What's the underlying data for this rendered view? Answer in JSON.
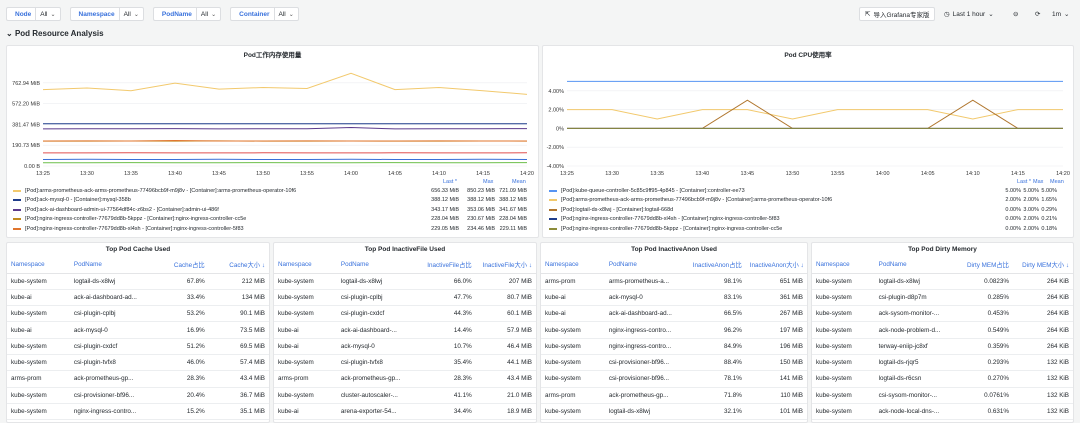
{
  "toolbar": {
    "variables": [
      {
        "label": "Node",
        "value": "All"
      },
      {
        "label": "Namespace",
        "value": "All"
      },
      {
        "label": "PodName",
        "value": "All"
      },
      {
        "label": "Container",
        "value": "All"
      }
    ],
    "import_label": "导入Grafana专家版",
    "time_range": "Last 1 hour",
    "refresh_interval": "1m"
  },
  "row_title": "Pod Resource Analysis",
  "memory_panel": {
    "title": "Pod工作内存使用量",
    "legend_headers": {
      "last": "Last *",
      "max": "Max",
      "mean": "Mean"
    },
    "legend": [
      {
        "name": "[Pod]:arms-prometheus-ack-arms-prometheus-77496bcb9f-m9j8v - [Container]:arms-prometheus-operator-10f6",
        "last": "656.33 MiB",
        "max": "850.23 MiB",
        "mean": "721.09 MiB",
        "color": "#f2c96d"
      },
      {
        "name": "[Pod]:ack-mysql-0 - [Container]:mysql-358b",
        "last": "388.12 MiB",
        "max": "388.12 MiB",
        "mean": "388.12 MiB",
        "color": "#1f3d8b"
      },
      {
        "name": "[Pod]:ack-ai-dashboard-admin-ui-77564df84c-z6bs2 - [Container]:admin-ui-486f",
        "last": "343.17 MiB",
        "max": "353.06 MiB",
        "mean": "341.67 MiB",
        "color": "#5b3a8c"
      },
      {
        "name": "[Pod]:nginx-ingress-controller-77679dd8b-5kppz - [Container]:nginx-ingress-controller-cc5e",
        "last": "228.04 MiB",
        "max": "230.67 MiB",
        "mean": "228.04 MiB",
        "color": "#c08a1e"
      },
      {
        "name": "[Pod]:nginx-ingress-controller-77679dd8b-xl4sh - [Container]:nginx-ingress-controller-5f83",
        "last": "229.05 MiB",
        "max": "234.46 MiB",
        "mean": "229.11 MiB",
        "color": "#e0752d"
      }
    ]
  },
  "cpu_panel": {
    "title": "Pod CPU使用率",
    "legend_headers": {
      "last": "Last *",
      "max": "Max",
      "mean": "Mean"
    },
    "legend": [
      {
        "name": "[Pod]:kube-queue-controller-5c85c9ff95-4p845 - [Container]:controller-ee73",
        "last": "5.00%",
        "max": "5.00%",
        "mean": "5.00%",
        "color": "#5794f2"
      },
      {
        "name": "[Pod]:arms-prometheus-ack-arms-prometheus-77496bcb9f-m9j8v - [Container]:arms-prometheus-operator-10f6",
        "last": "2.00%",
        "max": "2.00%",
        "mean": "1.65%",
        "color": "#f2c96d"
      },
      {
        "name": "[Pod]:logtail-ds-x8lwj - [Container]:logtail-668d",
        "last": "0.00%",
        "max": "3.00%",
        "mean": "0.29%",
        "color": "#b0762e"
      },
      {
        "name": "[Pod]:nginx-ingress-controller-77679dd8b-xl4sh - [Container]:nginx-ingress-controller-5f83",
        "last": "0.00%",
        "max": "2.00%",
        "mean": "0.21%",
        "color": "#1f3d8b"
      },
      {
        "name": "[Pod]:nginx-ingress-controller-77679dd8b-5kppz - [Container]:nginx-ingress-controller-cc5e",
        "last": "0.00%",
        "max": "2.00%",
        "mean": "0.18%",
        "color": "#8c8c3a"
      }
    ]
  },
  "chart_data": [
    {
      "type": "line",
      "title": "Pod工作内存使用量",
      "x": [
        "13:25",
        "13:30",
        "13:35",
        "13:40",
        "13:45",
        "13:50",
        "13:55",
        "14:00",
        "14:05",
        "14:10",
        "14:15",
        "14:20"
      ],
      "y_ticks": [
        "0.00 B",
        "190.73 MiB",
        "381.47 MiB",
        "572.20 MiB",
        "762.94 MiB"
      ],
      "ylim": [
        0,
        880
      ],
      "series": [
        {
          "name": "[Pod]:arms-prometheus-ack-arms-prometheus-77496bcb9f-m9j8v - [Container]:arms-prometheus-operator-10f6",
          "color": "#f2c96d",
          "values": [
            700,
            715,
            690,
            760,
            705,
            720,
            710,
            850,
            700,
            720,
            690,
            656
          ]
        },
        {
          "name": "[Pod]:ack-mysql-0 - [Container]:mysql-358b",
          "color": "#1f3d8b",
          "values": [
            388,
            388,
            388,
            388,
            388,
            388,
            388,
            388,
            388,
            388,
            388,
            388
          ]
        },
        {
          "name": "[Pod]:ack-ai-dashboard-admin-ui-77564df84c-z6bs2 - [Container]:admin-ui-486f",
          "color": "#5b3a8c",
          "values": [
            340,
            342,
            341,
            343,
            340,
            342,
            341,
            353,
            340,
            342,
            341,
            343
          ]
        },
        {
          "name": "[Pod]:nginx-ingress-controller-77679dd8b-5kppz - [Container]:nginx-ingress-controller-cc5e",
          "color": "#c08a1e",
          "values": [
            228,
            228,
            229,
            228,
            230,
            228,
            228,
            229,
            228,
            228,
            229,
            228
          ]
        },
        {
          "name": "[Pod]:nginx-ingress-controller-77679dd8b-xl4sh - [Container]:nginx-ingress-controller-5f83",
          "color": "#e0752d",
          "values": [
            229,
            230,
            229,
            234,
            229,
            229,
            230,
            229,
            229,
            230,
            229,
            229
          ]
        },
        {
          "name": "",
          "color": "#e05050",
          "values": [
            120,
            120,
            121,
            120,
            120,
            121,
            120,
            120,
            121,
            120,
            120,
            121
          ]
        },
        {
          "name": "",
          "color": "#3a6fd8",
          "values": [
            60,
            61,
            60,
            60,
            61,
            60,
            60,
            61,
            60,
            60,
            61,
            60
          ]
        },
        {
          "name": "",
          "color": "#6cbf4a",
          "values": [
            30,
            30,
            31,
            30,
            30,
            31,
            30,
            30,
            31,
            30,
            30,
            31
          ]
        }
      ]
    },
    {
      "type": "line",
      "title": "Pod CPU使用率",
      "x": [
        "13:25",
        "13:30",
        "13:35",
        "13:40",
        "13:45",
        "13:50",
        "13:55",
        "14:00",
        "14:05",
        "14:10",
        "14:15",
        "14:20"
      ],
      "y_ticks": [
        "-4.00%",
        "-2.00%",
        "0%",
        "2.00%",
        "4.00%"
      ],
      "ylim": [
        -4,
        6
      ],
      "series": [
        {
          "name": "[Pod]:kube-queue-controller-5c85c9ff95-4p845 - [Container]:controller-ee73",
          "color": "#5794f2",
          "values": [
            5,
            5,
            5,
            5,
            5,
            5,
            5,
            5,
            5,
            5,
            5,
            5
          ]
        },
        {
          "name": "[Pod]:arms-prometheus-ack-arms-prometheus-77496bcb9f-m9j8v - [Container]:arms-prometheus-operator-10f6",
          "color": "#f2c96d",
          "values": [
            2,
            2,
            1,
            2,
            2,
            1,
            2,
            2,
            2,
            1,
            2,
            2
          ]
        },
        {
          "name": "[Pod]:logtail-ds-x8lwj - [Container]:logtail-668d",
          "color": "#b0762e",
          "values": [
            0,
            0,
            0,
            0,
            3,
            0,
            0,
            0,
            0,
            3,
            0,
            0
          ]
        },
        {
          "name": "[Pod]:nginx-ingress-controller-77679dd8b-xl4sh - [Container]:nginx-ingress-controller-5f83",
          "color": "#1f3d8b",
          "values": [
            0,
            0,
            0,
            0,
            0,
            0,
            0,
            0,
            0,
            0,
            0,
            0
          ]
        },
        {
          "name": "[Pod]:nginx-ingress-controller-77679dd8b-5kppz - [Container]:nginx-ingress-controller-cc5e",
          "color": "#8c8c3a",
          "values": [
            0,
            0,
            0,
            0,
            0,
            0,
            0,
            0,
            0,
            0,
            0,
            0
          ]
        }
      ]
    }
  ],
  "tables": [
    {
      "title": "Top Pod Cache Used",
      "headers": [
        "Namespace",
        "PodName",
        "Cache占比",
        "Cache大小 ↓"
      ],
      "rows": [
        [
          "kube-system",
          "logtail-ds-x8lwj",
          "67.8%",
          "212 MiB"
        ],
        [
          "kube-ai",
          "ack-ai-dashboard-ad...",
          "33.4%",
          "134 MiB"
        ],
        [
          "kube-system",
          "csi-plugin-cplbj",
          "53.2%",
          "90.1 MiB"
        ],
        [
          "kube-ai",
          "ack-mysql-0",
          "16.9%",
          "73.5 MiB"
        ],
        [
          "kube-system",
          "csi-plugin-cxdcf",
          "51.2%",
          "69.5 MiB"
        ],
        [
          "kube-system",
          "csi-plugin-tvfx8",
          "46.0%",
          "57.4 MiB"
        ],
        [
          "arms-prom",
          "ack-prometheus-gp...",
          "28.3%",
          "43.4 MiB"
        ],
        [
          "kube-system",
          "csi-provisioner-bf96...",
          "20.4%",
          "36.7 MiB"
        ],
        [
          "kube-system",
          "nginx-ingress-contro...",
          "15.2%",
          "35.1 MiB"
        ]
      ]
    },
    {
      "title": "Top Pod InactiveFile Used",
      "headers": [
        "Namespace",
        "PodName",
        "InactiveFile占比",
        "InactiveFile大小 ↓"
      ],
      "rows": [
        [
          "kube-system",
          "logtail-ds-x8lwj",
          "66.0%",
          "207 MiB"
        ],
        [
          "kube-system",
          "csi-plugin-cplbj",
          "47.7%",
          "80.7 MiB"
        ],
        [
          "kube-system",
          "csi-plugin-cxdcf",
          "44.3%",
          "60.1 MiB"
        ],
        [
          "kube-ai",
          "ack-ai-dashboard-...",
          "14.4%",
          "57.9 MiB"
        ],
        [
          "kube-ai",
          "ack-mysql-0",
          "10.7%",
          "46.4 MiB"
        ],
        [
          "kube-system",
          "csi-plugin-tvfx8",
          "35.4%",
          "44.1 MiB"
        ],
        [
          "arms-prom",
          "ack-prometheus-gp...",
          "28.3%",
          "43.4 MiB"
        ],
        [
          "kube-system",
          "cluster-autoscaler-...",
          "41.1%",
          "21.0 MiB"
        ],
        [
          "kube-ai",
          "arena-exporter-54...",
          "34.4%",
          "18.9 MiB"
        ]
      ]
    },
    {
      "title": "Top Pod InactiveAnon Used",
      "headers": [
        "Namespace",
        "PodName",
        "InactiveAnon占比",
        "InactiveAnon大小 ↓"
      ],
      "rows": [
        [
          "arms-prom",
          "arms-prometheus-a...",
          "98.1%",
          "651 MiB"
        ],
        [
          "kube-ai",
          "ack-mysql-0",
          "83.1%",
          "361 MiB"
        ],
        [
          "kube-ai",
          "ack-ai-dashboard-ad...",
          "66.5%",
          "267 MiB"
        ],
        [
          "kube-system",
          "nginx-ingress-contro...",
          "96.2%",
          "197 MiB"
        ],
        [
          "kube-system",
          "nginx-ingress-contro...",
          "84.9%",
          "196 MiB"
        ],
        [
          "kube-system",
          "csi-provisioner-bf96...",
          "88.4%",
          "150 MiB"
        ],
        [
          "kube-system",
          "csi-provisioner-bf96...",
          "78.1%",
          "141 MiB"
        ],
        [
          "arms-prom",
          "ack-prometheus-gp...",
          "71.8%",
          "110 MiB"
        ],
        [
          "kube-system",
          "logtail-ds-x8lwj",
          "32.1%",
          "101 MiB"
        ]
      ]
    },
    {
      "title": "Top Pod Dirty Memory",
      "headers": [
        "Namespace",
        "PodName",
        "Dirty MEM占比",
        "Dirty MEM大小 ↓"
      ],
      "rows": [
        [
          "kube-system",
          "logtail-ds-x8lwj",
          "0.0823%",
          "264 KiB"
        ],
        [
          "kube-system",
          "csi-plugin-d8p7m",
          "0.285%",
          "264 KiB"
        ],
        [
          "kube-system",
          "ack-sysom-monitor-...",
          "0.453%",
          "264 KiB"
        ],
        [
          "kube-system",
          "ack-node-problem-d...",
          "0.549%",
          "264 KiB"
        ],
        [
          "kube-system",
          "terway-eniip-jc8xf",
          "0.359%",
          "264 KiB"
        ],
        [
          "kube-system",
          "logtail-ds-rjqr5",
          "0.293%",
          "132 KiB"
        ],
        [
          "kube-system",
          "logtail-ds-r6csn",
          "0.270%",
          "132 KiB"
        ],
        [
          "kube-system",
          "csi-sysom-monitor-...",
          "0.0761%",
          "132 KiB"
        ],
        [
          "kube-system",
          "ack-node-local-dns-...",
          "0.631%",
          "132 KiB"
        ]
      ]
    }
  ]
}
